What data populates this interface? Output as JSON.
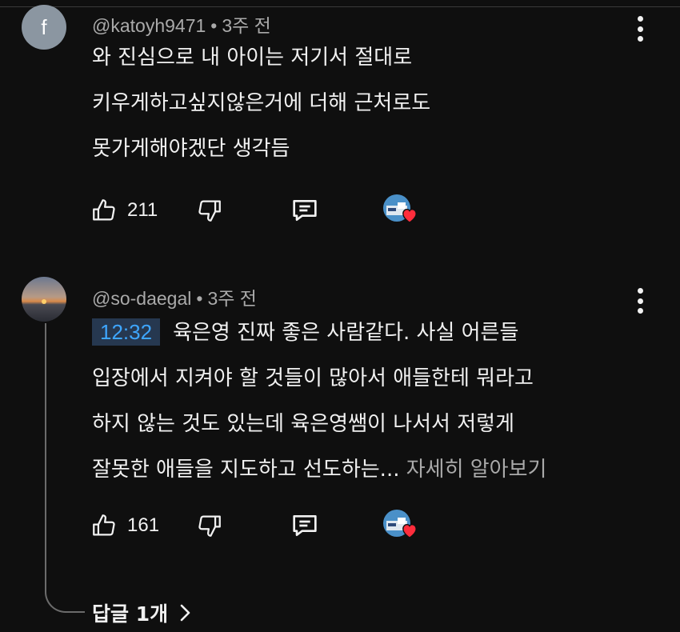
{
  "comments": [
    {
      "avatar_letter": "f",
      "author": "@katoyh9471",
      "time": "3주 전",
      "lines": [
        "와 진심으로 내 아이는 저기서 절대로",
        "키우게하고싶지않은거에 더해 근처로도",
        "못가게해야겠단 생각듬"
      ],
      "likes": "211",
      "creator_heart": true
    },
    {
      "avatar": "sunset-avatar",
      "author": "@so-daegal",
      "time": "3주 전",
      "timestamp": "12:32",
      "lines": [
        "육은영 진짜 좋은 사람같다.  사실 어른들",
        "입장에서 지켜야 할 것들이 많아서 애들한테 뭐라고",
        "하지 않는 것도 있는데 육은영쌤이 나서서 저렇게",
        "잘못한 애들을 지도하고 선도하는..."
      ],
      "read_more": "자세히 알아보기",
      "likes": "161",
      "creator_heart": true,
      "replies_label": "답글 1개"
    }
  ],
  "colors": {
    "background": "#0f0f0f",
    "timestamp_link": "#3ea6ff",
    "heart": "#ff2d3c"
  },
  "icons": [
    "thumbs-up-icon",
    "thumbs-down-icon",
    "reply-icon",
    "more-vert-icon",
    "heart-icon",
    "chevron-right-icon"
  ]
}
